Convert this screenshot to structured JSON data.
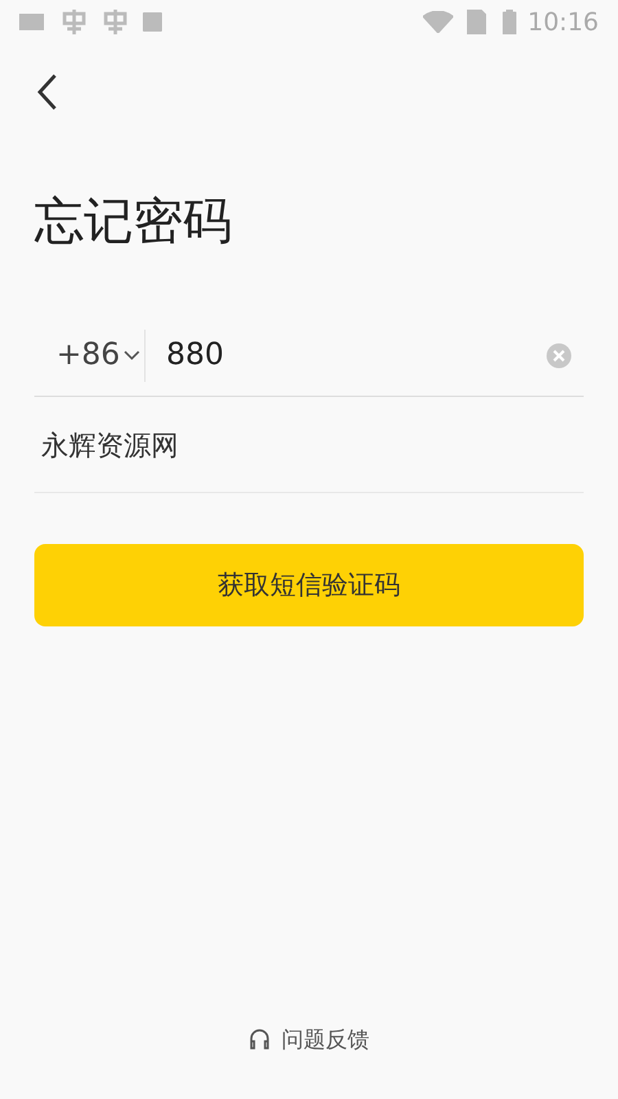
{
  "status_bar": {
    "time": "10:16"
  },
  "title": "忘记密码",
  "phone": {
    "country_code": "+86",
    "value": "880"
  },
  "second_field": {
    "value": "永辉资源网"
  },
  "submit_button": "获取短信验证码",
  "feedback_link": "问题反馈"
}
